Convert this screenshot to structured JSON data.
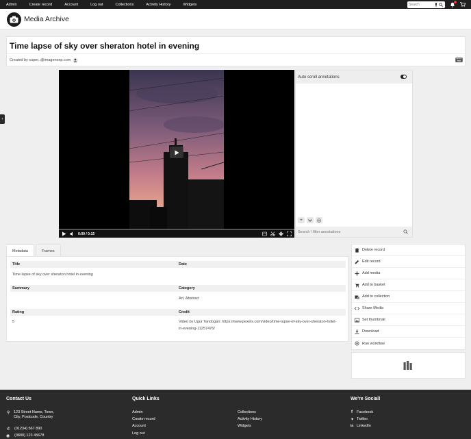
{
  "topnav": {
    "items": [
      "Admin",
      "Create record",
      "Account",
      "Log out",
      "Collections",
      "Activity History",
      "Widgets"
    ],
    "search_placeholder": "Search"
  },
  "header": {
    "app_title": "Media Archive"
  },
  "record": {
    "title": "Time lapse of sky over sheraton hotel in evening",
    "created_by": "Created by super..@imagenexp.com"
  },
  "video": {
    "time": "0:00 / 0:15"
  },
  "annotations": {
    "title": "Auto scroll annotations",
    "search_placeholder": "Search / filter annotations"
  },
  "tabs": [
    "Metadata",
    "Frames"
  ],
  "metadata": {
    "title_label": "Title",
    "title_value": "Time lapse of sky over sheraton hotel in evening",
    "date_label": "Date",
    "date_value": "",
    "summary_label": "Summary",
    "summary_value": "",
    "category_label": "Category",
    "category_value": "Art, Abstract",
    "rating_label": "Rating",
    "rating_value": "5",
    "credit_label": "Credit",
    "credit_value_1": "Video by Ugur Tandogan: https://www.pexels.com/video/time-lapse-of-sky-over-sheraton-hotel-",
    "credit_value_2": "in-evening-11257476/"
  },
  "actions": [
    {
      "label": "Delete record",
      "icon": "trash-icon"
    },
    {
      "label": "Edit record",
      "icon": "pencil-icon"
    },
    {
      "label": "Add media",
      "icon": "plus-icon"
    },
    {
      "label": "Add to basket",
      "icon": "cart-icon"
    },
    {
      "label": "Add to collection",
      "icon": "collection-icon"
    },
    {
      "label": "Share Media",
      "icon": "code-icon"
    },
    {
      "label": "Set thumbnail",
      "icon": "image-icon"
    },
    {
      "label": "Download",
      "icon": "download-icon"
    },
    {
      "label": "Run workflow",
      "icon": "workflow-icon"
    }
  ],
  "footer": {
    "contact_title": "Contact Us",
    "address_1": "123 Street Name, Town,",
    "address_2": "City, Postcode, Country",
    "phone_1": "(01234) 567 890",
    "phone_2": "(0800) 123 45678",
    "links_title": "Quick Links",
    "links_col1": [
      "Admin",
      "Create record",
      "Account",
      "Log out"
    ],
    "links_col2": [
      "Collections",
      "Activity History",
      "Widgets"
    ],
    "social_title": "We're Social!",
    "social": [
      "Facebook",
      "Twitter",
      "LinkedIn"
    ]
  },
  "colors": {
    "topbar": "#1f1f1f",
    "footer": "#2b2b2b",
    "accent_red": "#e53935"
  }
}
